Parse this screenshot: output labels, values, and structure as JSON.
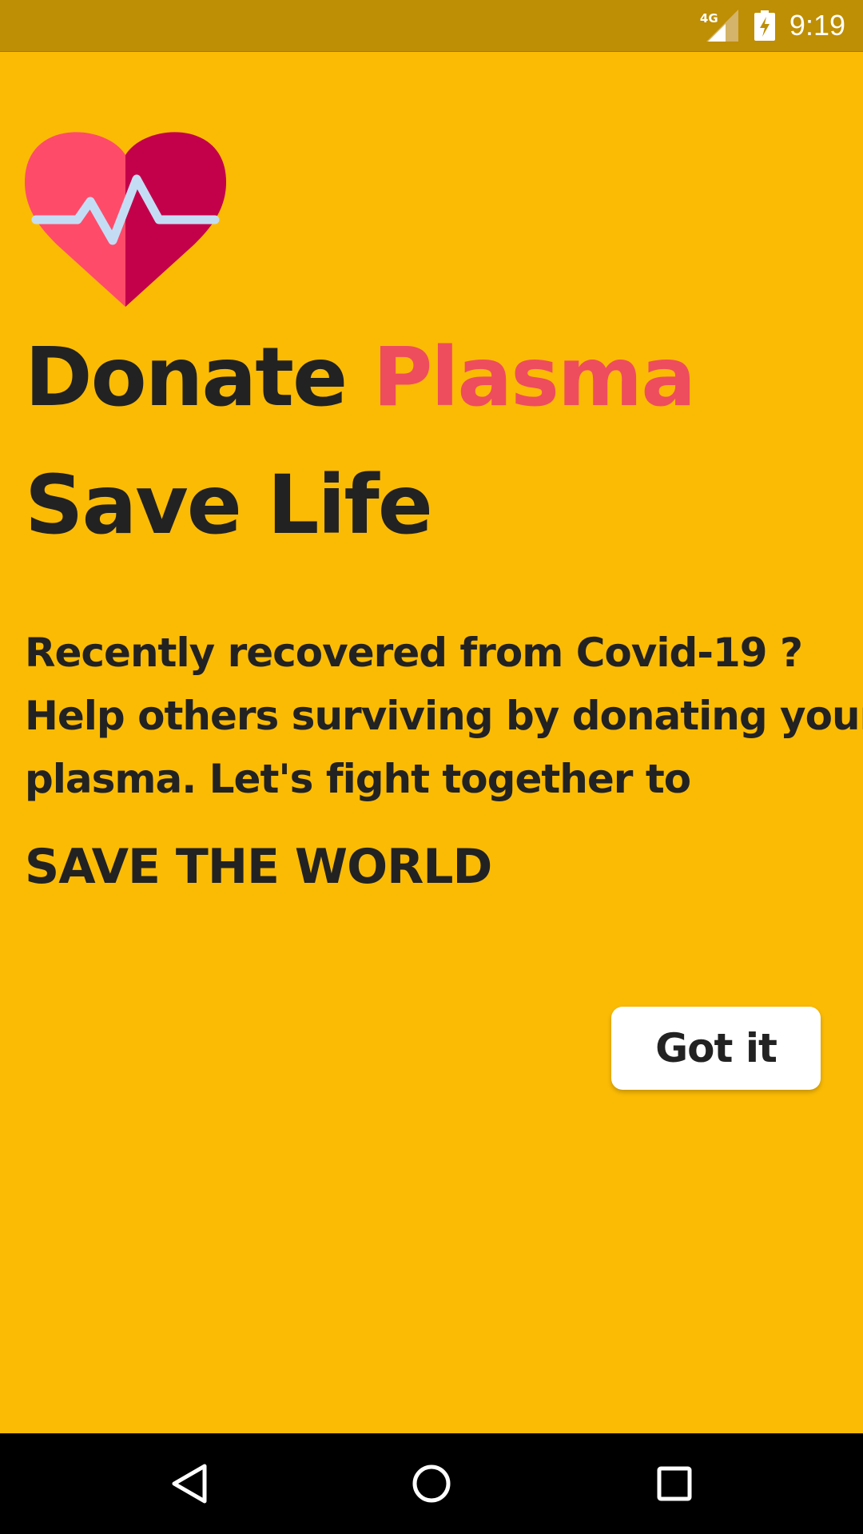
{
  "status_bar": {
    "network": "4G",
    "time": "9:19",
    "icons": [
      "signal-icon",
      "battery-charging-icon"
    ]
  },
  "colors": {
    "background": "#FBBB05",
    "status_bar": "#BE8E05",
    "accent": "#EE4D5D",
    "text": "#222222",
    "heart_light": "#FF4B6A",
    "heart_dark": "#C3004A",
    "pulse_line": "#C4DDF5"
  },
  "main": {
    "logo_icon": "heart-pulse-icon",
    "headline": {
      "word1": "Donate",
      "word2": "Plasma",
      "line2": "Save Life"
    },
    "body": [
      "Recently recovered from Covid-19 ?",
      "Help others surviving by donating your",
      "plasma. Let's fight together to"
    ],
    "emphasis": "SAVE THE WORLD",
    "button_label": "Got it"
  },
  "nav_bar": {
    "buttons": [
      "back-icon",
      "home-icon",
      "recents-icon"
    ]
  }
}
